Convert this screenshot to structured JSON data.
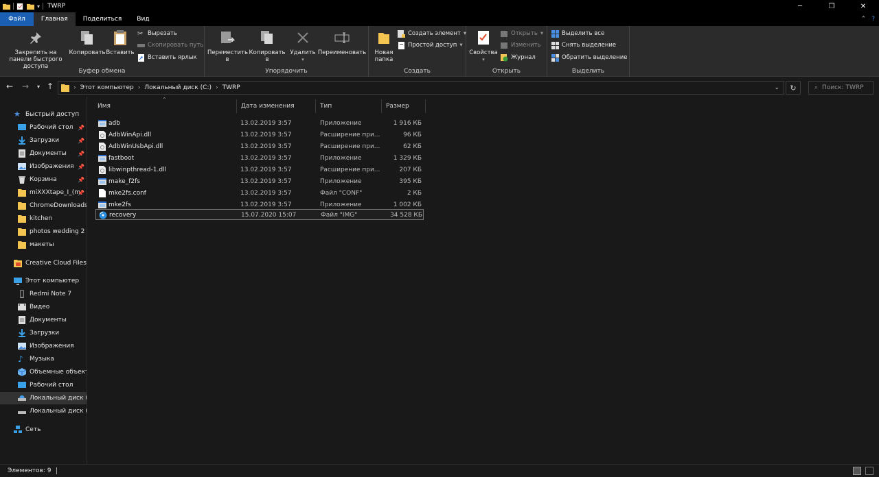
{
  "window": {
    "title": "TWRP"
  },
  "tabs": [
    "Файл",
    "Главная",
    "Поделиться",
    "Вид"
  ],
  "ribbon": {
    "clipboard": {
      "label": "Буфер обмена",
      "pin_label": "Закрепить на панели быстрого доступа",
      "copy_label": "Копировать",
      "paste_label": "Вставить",
      "cut_label": "Вырезать",
      "copy_path_label": "Скопировать путь",
      "paste_shortcut_label": "Вставить ярлык"
    },
    "organize": {
      "label": "Упорядочить",
      "move_label": "Переместить в",
      "copyto_label": "Копировать в",
      "delete_label": "Удалить",
      "rename_label": "Переименовать"
    },
    "new": {
      "label": "Создать",
      "new_folder_label": "Новая папка",
      "new_item_label": "Создать элемент",
      "easy_access_label": "Простой доступ"
    },
    "open": {
      "label": "Открыть",
      "properties_label": "Свойства",
      "open_label": "Открыть",
      "edit_label": "Изменить",
      "history_label": "Журнал"
    },
    "select": {
      "label": "Выделить",
      "select_all_label": "Выделить все",
      "select_none_label": "Снять выделение",
      "invert_label": "Обратить выделение"
    }
  },
  "address": {
    "crumbs": [
      "Этот компьютер",
      "Локальный диск (C:)",
      "TWRP"
    ],
    "search_placeholder": "Поиск: TWRP"
  },
  "nav": {
    "quick_access": "Быстрый доступ",
    "quick_items": [
      "Рабочий стол",
      "Загрузки",
      "Документы",
      "Изображения",
      "Корзина",
      "miXXXtape_I_(m",
      "ChromeDownloads",
      "kitchen",
      "photos wedding 2",
      "макеты"
    ],
    "creative_cloud": "Creative Cloud Files",
    "this_pc": "Этот компьютер",
    "pc_items": [
      "Redmi Note 7",
      "Видео",
      "Документы",
      "Загрузки",
      "Изображения",
      "Музыка",
      "Объемные объекты",
      "Рабочий стол",
      "Локальный диск (C",
      "Локальный диск (D"
    ],
    "network": "Сеть"
  },
  "columns": {
    "name": "Имя",
    "date": "Дата изменения",
    "type": "Тип",
    "size": "Размер"
  },
  "files": [
    {
      "name": "adb",
      "date": "13.02.2019 3:57",
      "type": "Приложение",
      "size": "1 916 КБ",
      "icon": "app-icon"
    },
    {
      "name": "AdbWinApi.dll",
      "date": "13.02.2019 3:57",
      "type": "Расширение при...",
      "size": "96 КБ",
      "icon": "dll-icon"
    },
    {
      "name": "AdbWinUsbApi.dll",
      "date": "13.02.2019 3:57",
      "type": "Расширение при...",
      "size": "62 КБ",
      "icon": "dll-icon"
    },
    {
      "name": "fastboot",
      "date": "13.02.2019 3:57",
      "type": "Приложение",
      "size": "1 329 КБ",
      "icon": "app-icon"
    },
    {
      "name": "libwinpthread-1.dll",
      "date": "13.02.2019 3:57",
      "type": "Расширение при...",
      "size": "207 КБ",
      "icon": "dll-icon"
    },
    {
      "name": "make_f2fs",
      "date": "13.02.2019 3:57",
      "type": "Приложение",
      "size": "395 КБ",
      "icon": "app-icon"
    },
    {
      "name": "mke2fs.conf",
      "date": "13.02.2019 3:57",
      "type": "Файл \"CONF\"",
      "size": "2 КБ",
      "icon": "file-icon"
    },
    {
      "name": "mke2fs",
      "date": "13.02.2019 3:57",
      "type": "Приложение",
      "size": "1 002 КБ",
      "icon": "app-icon"
    },
    {
      "name": "recovery",
      "date": "15.07.2020 15:07",
      "type": "Файл \"IMG\"",
      "size": "34 528 КБ",
      "icon": "disc-image-icon"
    }
  ],
  "status": {
    "count_text": "Элементов: 9"
  },
  "colors": {
    "accent": "#1a5fb4",
    "folder": "#f4c550",
    "background": "#191919",
    "ribbon": "#2b2b2b"
  }
}
